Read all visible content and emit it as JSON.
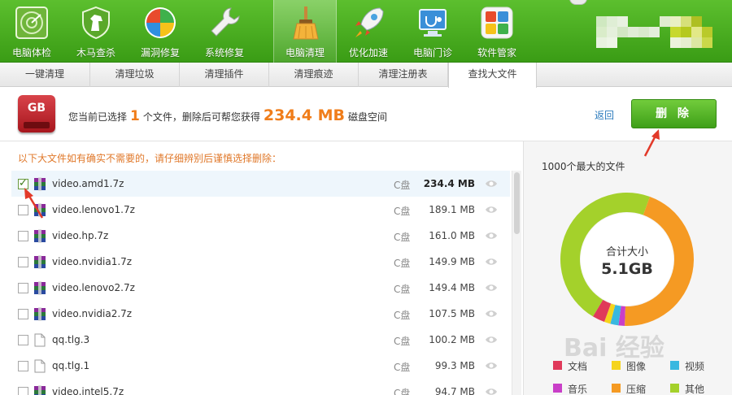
{
  "toolbar": {
    "items": [
      {
        "label": "电脑体检",
        "icon": "radar-check-icon"
      },
      {
        "label": "木马查杀",
        "icon": "horse-shield-icon"
      },
      {
        "label": "漏洞修复",
        "icon": "windows-patch-icon"
      },
      {
        "label": "系统修复",
        "icon": "wrench-icon"
      },
      {
        "label": "电脑清理",
        "icon": "broom-icon",
        "active": true
      },
      {
        "label": "优化加速",
        "icon": "rocket-icon"
      },
      {
        "label": "电脑门诊",
        "icon": "monitor-stethoscope-icon"
      },
      {
        "label": "软件管家",
        "icon": "software-grid-icon"
      }
    ]
  },
  "tabs": [
    {
      "label": "一键清理"
    },
    {
      "label": "清理垃圾"
    },
    {
      "label": "清理插件"
    },
    {
      "label": "清理痕迹"
    },
    {
      "label": "清理注册表"
    },
    {
      "label": "查找大文件",
      "active": true
    }
  ],
  "header": {
    "badge": "GB",
    "summary_prefix": "您当前已选择",
    "selected_count": "1",
    "summary_mid": "个文件，删除后可帮您获得",
    "freed_space": "234.4 MB",
    "summary_suffix": "磁盘空间",
    "back_label": "返回",
    "delete_label": "删 除"
  },
  "hint": "以下大文件如有确实不需要的，请仔细辨别后谨慎选择删除：",
  "files": [
    {
      "name": "video.amd1.7z",
      "drive": "C盘",
      "size": "234.4 MB",
      "checked": true
    },
    {
      "name": "video.lenovo1.7z",
      "drive": "C盘",
      "size": "189.1 MB",
      "checked": false
    },
    {
      "name": "video.hp.7z",
      "drive": "C盘",
      "size": "161.0 MB",
      "checked": false
    },
    {
      "name": "video.nvidia1.7z",
      "drive": "C盘",
      "size": "149.9 MB",
      "checked": false
    },
    {
      "name": "video.lenovo2.7z",
      "drive": "C盘",
      "size": "149.4 MB",
      "checked": false
    },
    {
      "name": "video.nvidia2.7z",
      "drive": "C盘",
      "size": "107.5 MB",
      "checked": false
    },
    {
      "name": "qq.tlg.3",
      "drive": "C盘",
      "size": "100.2 MB",
      "checked": false
    },
    {
      "name": "qq.tlg.1",
      "drive": "C盘",
      "size": "99.3 MB",
      "checked": false
    },
    {
      "name": "video.intel5.7z",
      "drive": "C盘",
      "size": "94.7 MB",
      "checked": false
    }
  ],
  "panel": {
    "title": "1000个最大的文件",
    "donut_label": "合计大小",
    "donut_total": "5.1GB",
    "segments": [
      {
        "name": "压缩",
        "fraction": 0.45,
        "color": "#f59a23"
      },
      {
        "name": "其他",
        "fraction": 0.47,
        "color": "#a4d12b"
      },
      {
        "name": "文档",
        "fraction": 0.03,
        "color": "#e0395a"
      },
      {
        "name": "图像",
        "fraction": 0.015,
        "color": "#f5d41c"
      },
      {
        "name": "视频",
        "fraction": 0.02,
        "color": "#39b8e0"
      },
      {
        "name": "音乐",
        "fraction": 0.015,
        "color": "#c93fc8"
      }
    ],
    "legend": [
      {
        "label": "文档",
        "color": "#e0395a"
      },
      {
        "label": "图像",
        "color": "#f5d41c"
      },
      {
        "label": "视频",
        "color": "#39b8e0"
      },
      {
        "label": "音乐",
        "color": "#c93fc8"
      },
      {
        "label": "压缩",
        "color": "#f59a23"
      },
      {
        "label": "其他",
        "color": "#a4d12b"
      }
    ]
  },
  "watermark": "Bai 经验"
}
